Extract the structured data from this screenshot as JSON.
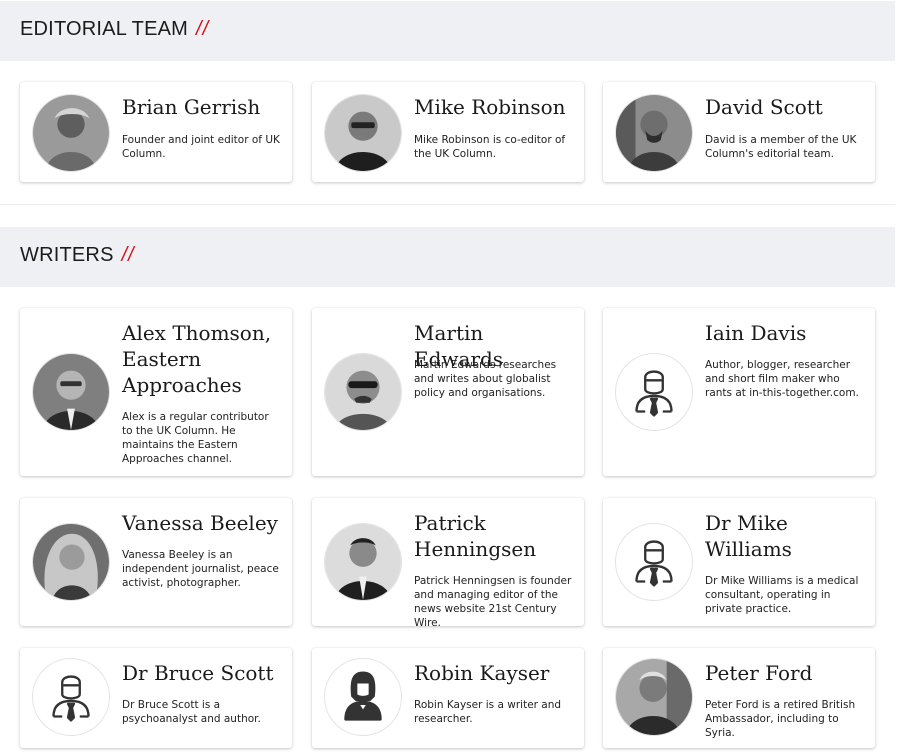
{
  "sections": [
    {
      "title": "EDITORIAL TEAM",
      "slashes": "//"
    },
    {
      "title": "WRITERS",
      "slashes": "//"
    }
  ],
  "editorial_team": [
    {
      "name": "Brian Gerrish",
      "bio": "Founder and joint editor of UK Column.",
      "avatar": "photo"
    },
    {
      "name": "Mike Robinson",
      "bio": "Mike Robinson is co-editor of the UK Column.",
      "avatar": "photo"
    },
    {
      "name": "David Scott",
      "bio": "David is a member of the UK Column's editorial team.",
      "avatar": "photo"
    }
  ],
  "writers": [
    {
      "name": "Alex Thomson, Eastern Approaches",
      "bio": "Alex is a regular contributor to the UK Column. He maintains the Eastern Approaches channel.",
      "avatar": "photo"
    },
    {
      "name": "Martin Edwards",
      "bio": "Martin Edwards researches and writes about globalist policy and organisations.",
      "avatar": "photo"
    },
    {
      "name": "Iain Davis",
      "bio": "Author, blogger, researcher and short film maker who rants at in-this-together.com.",
      "avatar": "person-placeholder-icon"
    },
    {
      "name": "Vanessa Beeley",
      "bio": "Vanessa Beeley is an independent journalist, peace activist, photographer.",
      "avatar": "photo"
    },
    {
      "name": "Patrick Henningsen",
      "bio": "Patrick Henningsen is founder and managing editor of the news website 21st Century Wire.",
      "avatar": "photo"
    },
    {
      "name": "Dr Mike Williams",
      "bio": "Dr Mike Williams is a medical consultant, operating in private practice.",
      "avatar": "person-placeholder-icon"
    },
    {
      "name": "Dr Bruce Scott",
      "bio": "Dr Bruce Scott is a psychoanalyst and author.",
      "avatar": "person-placeholder-icon"
    },
    {
      "name": "Robin Kayser",
      "bio": "Robin Kayser is a writer and researcher.",
      "avatar": "female-person-placeholder-icon"
    },
    {
      "name": "Peter Ford",
      "bio": "Peter Ford is a retired British Ambassador, including to Syria.",
      "avatar": "photo"
    }
  ],
  "colors": {
    "accent": "#d0121b",
    "section_bg": "#eef0f3"
  }
}
